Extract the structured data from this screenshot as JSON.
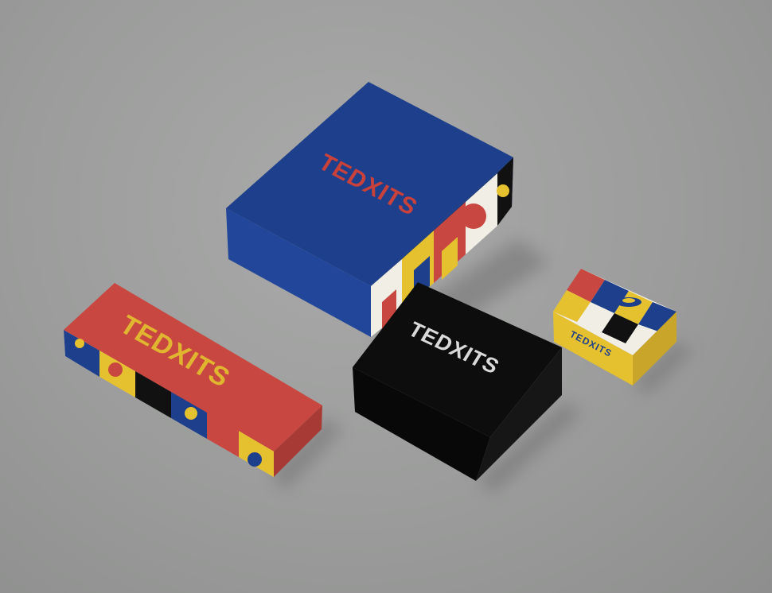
{
  "scene": {
    "description_visible": false,
    "background_color": "#9e9f9e"
  },
  "boxes": {
    "blue_box": {
      "label": "TEDXITS",
      "top_color": "#1d3f8c",
      "text_color": "#c9413b"
    },
    "red_box": {
      "label": "TEDXITS",
      "top_color": "#c94741",
      "text_color": "#e0b52f"
    },
    "black_box": {
      "label": "TEDXITS",
      "top_color": "#0d0d0d",
      "text_color": "#d9d9d9"
    },
    "yellow_box": {
      "label": "TEDXITS",
      "top_color": "#e6c12f",
      "text_color": "#1d3f8c"
    }
  },
  "pattern_colors": [
    "#1d3f8c",
    "#c94741",
    "#e6c12f",
    "#f1eee6",
    "#111111"
  ]
}
